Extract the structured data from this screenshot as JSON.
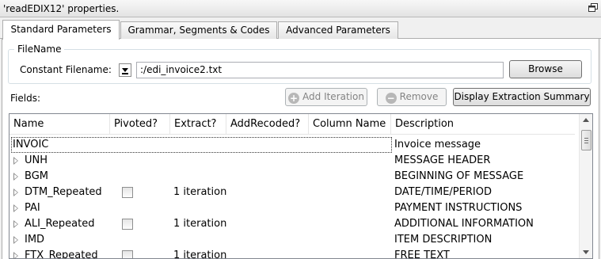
{
  "window": {
    "title": "'readEDIX12' properties."
  },
  "tabs": [
    {
      "label": "Standard Parameters"
    },
    {
      "label": "Grammar, Segments & Codes"
    },
    {
      "label": "Advanced Parameters"
    }
  ],
  "filename": {
    "group_label": "FileName",
    "constant_label": "Constant Filename:",
    "value": ":/edi_invoice2.txt",
    "browse_label": "Browse"
  },
  "fields": {
    "label": "Fields:",
    "add_iteration_label": "Add Iteration",
    "remove_label": "Remove",
    "summary_label": "Display Extraction Summary"
  },
  "columns": [
    "Name",
    "Pivoted?",
    "Extract?",
    "AddRecoded?",
    "Column Name",
    "Description"
  ],
  "rows": [
    {
      "name": "INVOIC",
      "expand": false,
      "pivoted": false,
      "extract": "",
      "description": "Invoice message"
    },
    {
      "name": "UNH",
      "expand": true,
      "pivoted": false,
      "extract": "",
      "description": "MESSAGE HEADER"
    },
    {
      "name": "BGM",
      "expand": true,
      "pivoted": false,
      "extract": "",
      "description": "BEGINNING OF MESSAGE"
    },
    {
      "name": "DTM_Repeated",
      "expand": true,
      "pivoted": true,
      "extract": "1 iteration",
      "description": "DATE/TIME/PERIOD"
    },
    {
      "name": "PAI",
      "expand": true,
      "pivoted": false,
      "extract": "",
      "description": "PAYMENT INSTRUCTIONS"
    },
    {
      "name": "ALI_Repeated",
      "expand": true,
      "pivoted": true,
      "extract": "1 iteration",
      "description": "ADDITIONAL INFORMATION"
    },
    {
      "name": "IMD",
      "expand": true,
      "pivoted": false,
      "extract": "",
      "description": "ITEM DESCRIPTION"
    },
    {
      "name": "FTX_Repeated",
      "expand": true,
      "pivoted": true,
      "extract": "1 iteration",
      "description": "FREE TEXT"
    }
  ]
}
